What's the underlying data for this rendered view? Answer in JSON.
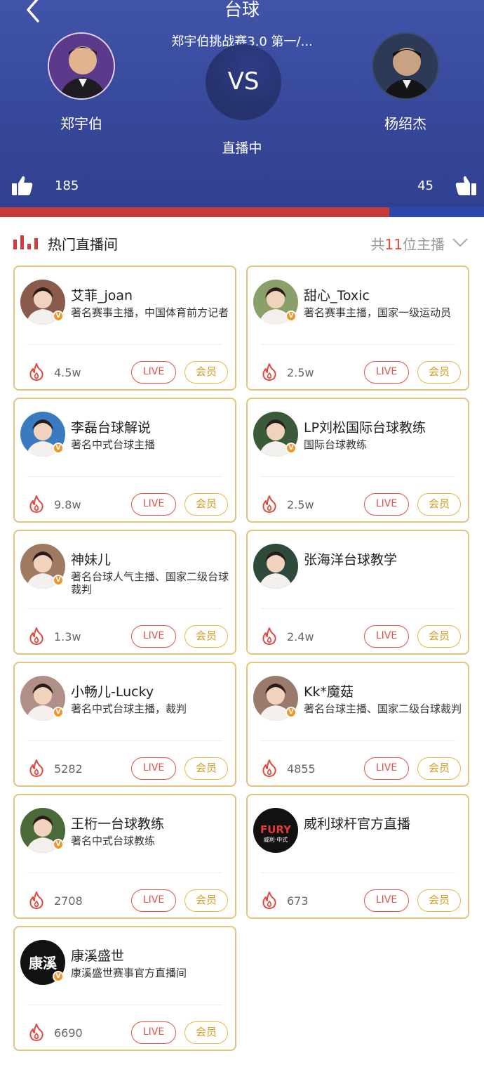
{
  "header": {
    "title": "台球",
    "match_name": "郑宇伯挑战赛3.0 第一/...",
    "vs": "VS",
    "status": "直播中",
    "player_left": {
      "name": "郑宇伯",
      "likes": "185"
    },
    "player_right": {
      "name": "杨绍杰",
      "likes": "45"
    },
    "vote_share_left": 0.804
  },
  "section": {
    "title": "热门直播间",
    "count_prefix": "共",
    "count": "11",
    "count_suffix": "位主播"
  },
  "colors": {
    "header_blue": "#37489a",
    "vote_red": "#c63a37",
    "vote_blue": "#2d48a8",
    "card_border": "#e6c47d",
    "live_red": "#e0534a",
    "vip_gold": "#d69a1e"
  },
  "streamers": [
    {
      "name": "艾菲_joan",
      "desc": "著名赛事主播，中国体育前方记者",
      "viewers": "4.5w",
      "live": "LIVE",
      "vip": "会员",
      "verified": "V",
      "avatar_color": "#8a5a4a"
    },
    {
      "name": "甜心_Toxic",
      "desc": "著名赛事主播，国家一级运动员",
      "viewers": "2.5w",
      "live": "LIVE",
      "vip": "会员",
      "verified": "V",
      "avatar_color": "#8aa06a"
    },
    {
      "name": "李磊台球解说",
      "desc": "著名中式台球主播",
      "viewers": "9.8w",
      "live": "LIVE",
      "vip": "会员",
      "verified": "V",
      "avatar_color": "#3a7ac0"
    },
    {
      "name": "LP刘松国际台球教练",
      "desc": "国际台球教练",
      "viewers": "2.5w",
      "live": "LIVE",
      "vip": "会员",
      "verified": "V",
      "avatar_color": "#3b5a3a"
    },
    {
      "name": "神妹儿",
      "desc": "著名台球人气主播、国家二级台球裁判",
      "viewers": "1.3w",
      "live": "LIVE",
      "vip": "会员",
      "verified": "V",
      "avatar_color": "#a07a60"
    },
    {
      "name": "张海洋台球教学",
      "desc": "",
      "viewers": "2.4w",
      "live": "LIVE",
      "vip": "会员",
      "verified": "",
      "avatar_color": "#2d4a3a"
    },
    {
      "name": "小畅儿-Lucky",
      "desc": "著名中式台球主播，裁判",
      "viewers": "5282",
      "live": "LIVE",
      "vip": "会员",
      "verified": "V",
      "avatar_color": "#b08f88"
    },
    {
      "name": "Kk*魔菇",
      "desc": "著名台球主播、国家二级台球裁判",
      "viewers": "4855",
      "live": "LIVE",
      "vip": "会员",
      "verified": "V",
      "avatar_color": "#9a7a6a"
    },
    {
      "name": "王桁一台球教练",
      "desc": "著名中式台球教练",
      "viewers": "2708",
      "live": "LIVE",
      "vip": "会员",
      "verified": "V",
      "avatar_color": "#4a6a3a"
    },
    {
      "name": "威利球杆官方直播",
      "desc": "",
      "viewers": "673",
      "live": "LIVE",
      "vip": "会员",
      "verified": "",
      "avatar_color": "#111111",
      "logo_text": "FURY",
      "logo_sub": "威利·中式"
    },
    {
      "name": "康溪盛世",
      "desc": "康溪盛世赛事官方直播间",
      "viewers": "6690",
      "live": "LIVE",
      "vip": "会员",
      "verified": "V",
      "avatar_color": "#111111",
      "logo_text": "康溪"
    }
  ]
}
